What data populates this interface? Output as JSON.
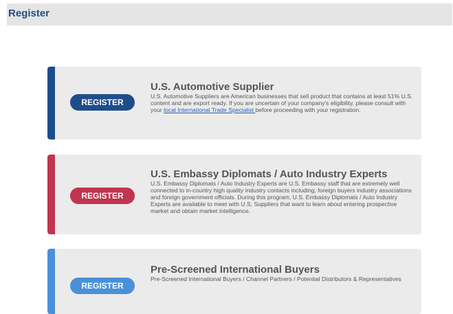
{
  "header": {
    "title": "Register"
  },
  "colors": {
    "navy": "#1e4d8c",
    "crimson": "#c0354f",
    "sky": "#4a90d9"
  },
  "cards": [
    {
      "accent": "#1e4d8c",
      "button_label": "REGISTER",
      "title": "U.S. Automotive Supplier",
      "description_before_link": "U.S. Automotive Suppliers are American businesses that sell product that contains at least 51% U.S. content and are export ready. If you are uncertain of your company's eligibility, please consult with your ",
      "link_text": "local International Trade Specialist ",
      "description_after_link": "before proceeding with your registration."
    },
    {
      "accent": "#c0354f",
      "button_label": "REGISTER",
      "title": "U.S. Embassy Diplomats / Auto Industry Experts",
      "description": "U.S. Embassy Diplomats / Auto Industry Experts are U.S. Embassy staff that are extremely well connected to in-country high quality industry contacts including, foreign buyers industry associations and foreign government officials. During this program, U.S. Embassy Diplomats / Auto Industry Experts are available to meet with U.S, Suppliers that want to learn about entering prospective market and obtain market intelligence."
    },
    {
      "accent": "#4a90d9",
      "button_label": "REGISTER",
      "title": "Pre-Screened International Buyers",
      "description": "Pre-Screened International Buyers / Channel Partners / Potential Distributors & Representatives"
    }
  ]
}
